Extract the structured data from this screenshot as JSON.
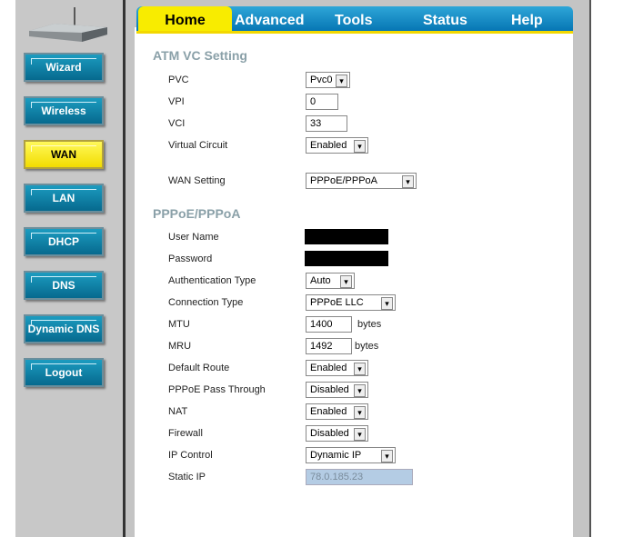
{
  "tabs": [
    "Home",
    "Advanced",
    "Tools",
    "Status",
    "Help"
  ],
  "sidebar": [
    "Wizard",
    "Wireless",
    "WAN",
    "LAN",
    "DHCP",
    "DNS",
    "Dynamic DNS",
    "Logout"
  ],
  "atm": {
    "title": "ATM VC Setting",
    "pvc_label": "PVC",
    "pvc": "Pvc0",
    "vpi_label": "VPI",
    "vpi": "0",
    "vci_label": "VCI",
    "vci": "33",
    "vc_label": "Virtual Circuit",
    "vc": "Enabled",
    "wan_label": "WAN Setting",
    "wan": "PPPoE/PPPoA"
  },
  "pppoe": {
    "title": "PPPoE/PPPoA",
    "user_label": "User Name",
    "pass_label": "Password",
    "auth_label": "Authentication Type",
    "auth": "Auto",
    "conn_label": "Connection Type",
    "conn": "PPPoE LLC",
    "mtu_label": "MTU",
    "mtu": "1400",
    "mru_label": "MRU",
    "mru": "1492",
    "unit": "bytes",
    "route_label": "Default Route",
    "route": "Enabled",
    "pass_through_label": "PPPoE Pass Through",
    "pass_through": "Disabled",
    "nat_label": "NAT",
    "nat": "Enabled",
    "fw_label": "Firewall",
    "fw": "Disabled",
    "ipc_label": "IP Control",
    "ipc": "Dynamic IP",
    "static_label": "Static IP",
    "static": "78.0.185.23"
  }
}
